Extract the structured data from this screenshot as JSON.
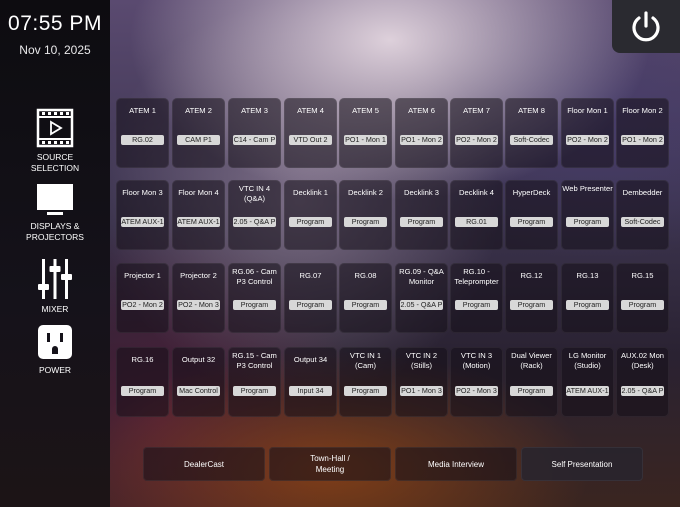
{
  "clock": {
    "time": "07:55 PM",
    "date": "Nov 10, 2025"
  },
  "sidebar": {
    "items": [
      {
        "label": "SOURCE SELECTION",
        "icon": "film-play-icon"
      },
      {
        "label": "DISPLAYS & PROJECTORS",
        "icon": "monitor-icon"
      },
      {
        "label": "MIXER",
        "icon": "mixer-sliders-icon"
      },
      {
        "label": "POWER",
        "icon": "power-outlet-icon"
      }
    ]
  },
  "power_button": {
    "icon": "power-icon"
  },
  "grid": {
    "rows": [
      [
        {
          "label": "ATEM 1",
          "value": "RG.02"
        },
        {
          "label": "ATEM 2",
          "value": "CAM  P1"
        },
        {
          "label": "ATEM 3",
          "value": "C14 - Cam P"
        },
        {
          "label": "ATEM 4",
          "value": "VTD Out 2"
        },
        {
          "label": "ATEM 5",
          "value": "PO1 - Mon 1"
        },
        {
          "label": "ATEM 6",
          "value": "PO1 - Mon 2"
        },
        {
          "label": "ATEM 7",
          "value": "PO2 - Mon 2"
        },
        {
          "label": "ATEM 8",
          "value": "Soft-Codec"
        },
        {
          "label": "Floor Mon 1",
          "value": "PO2 - Mon 2"
        },
        {
          "label": "Floor Mon 2",
          "value": "PO1 - Mon 2"
        }
      ],
      [
        {
          "label": "Floor Mon 3",
          "value": "ATEM AUX-1"
        },
        {
          "label": "Floor Mon 4",
          "value": "ATEM AUX-1"
        },
        {
          "label": "VTC IN 4 (Q&A)",
          "value": "2.05 - Q&A P"
        },
        {
          "label": "Decklink 1",
          "value": "Program"
        },
        {
          "label": "Decklink 2",
          "value": "Program"
        },
        {
          "label": "Decklink 3",
          "value": "Program"
        },
        {
          "label": "Decklink 4",
          "value": "RG.01"
        },
        {
          "label": "HyperDeck",
          "value": "Program"
        },
        {
          "label": "Web Presenter",
          "value": "Program"
        },
        {
          "label": "Dembedder",
          "value": "Soft-Codec"
        }
      ],
      [
        {
          "label": "Projector 1",
          "value": "PO2 - Mon 2"
        },
        {
          "label": "Projector 2",
          "value": "PO2 - Mon 3"
        },
        {
          "label": "RG.06 - Cam P3 Control",
          "value": "Program"
        },
        {
          "label": "RG.07",
          "value": "Program"
        },
        {
          "label": "RG.08",
          "value": "Program"
        },
        {
          "label": "RG.09 - Q&A Monitor",
          "value": "2.05 - Q&A P"
        },
        {
          "label": "RG.10 - Teleprompter",
          "value": "Program"
        },
        {
          "label": "RG.12",
          "value": "Program"
        },
        {
          "label": "RG.13",
          "value": "Program"
        },
        {
          "label": "RG.15",
          "value": "Program"
        }
      ],
      [
        {
          "label": "RG.16",
          "value": "Program"
        },
        {
          "label": "Output 32",
          "value": "Mac Control"
        },
        {
          "label": "RG.15 - Cam P3 Control",
          "value": "Program"
        },
        {
          "label": "Output 34",
          "value": "Input 34"
        },
        {
          "label": "VTC IN 1 (Cam)",
          "value": "Program"
        },
        {
          "label": "VTC IN 2 (Stills)",
          "value": "PO1 - Mon 3"
        },
        {
          "label": "VTC IN 3 (Motion)",
          "value": "PO2 - Mon 3"
        },
        {
          "label": "Dual Viewer (Rack)",
          "value": "Program"
        },
        {
          "label": "LG Monitor (Studio)",
          "value": "ATEM AUX-1"
        },
        {
          "label": "AUX.02 Mon (Desk)",
          "value": "2.05 - Q&A P"
        }
      ]
    ]
  },
  "presets": [
    {
      "label": "DealerCast",
      "active": false
    },
    {
      "label": "Town-Hall / Meeting",
      "active": false
    },
    {
      "label": "Media Interview",
      "active": false
    },
    {
      "label": "Self Presentation",
      "active": true
    }
  ]
}
